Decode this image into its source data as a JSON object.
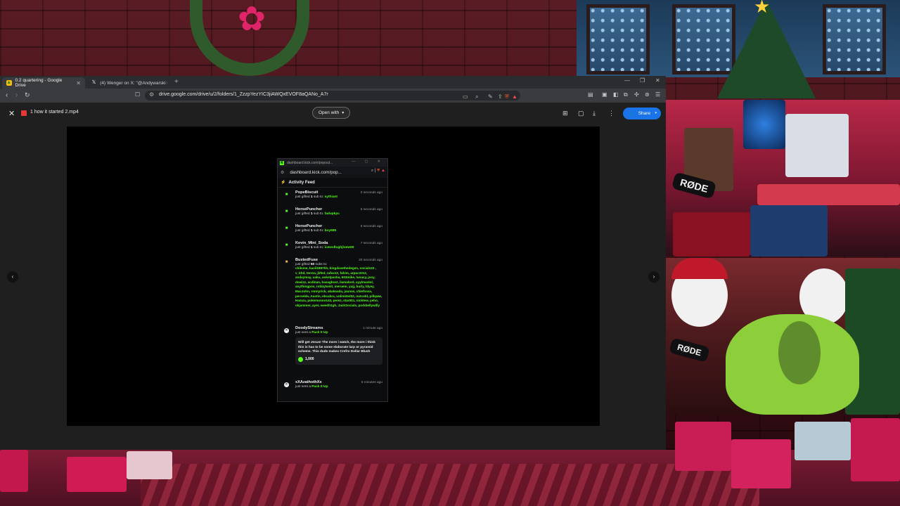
{
  "browser": {
    "tabs": [
      {
        "label": "0.2 quartering - Google Drive",
        "active": true,
        "icon": "google-drive-icon"
      },
      {
        "label": "(4) Wenger on X: \"@Andywarski http",
        "active": false,
        "icon": "x-logo-icon"
      }
    ],
    "url": "drive.google.com/drive/u/2/folders/1_ZzzpYezYIC3jiAWQxEVOF8aQANo_A7r"
  },
  "viewer": {
    "file_name": "1 how it started 2.mp4",
    "open_with_label": "Open with",
    "share_label": "Share"
  },
  "kick": {
    "titlebar_url": "dashboard.kick.com/popout...",
    "address": "dashboard.kick.com/pop...",
    "feed_title": "Activity Feed",
    "items": [
      {
        "user": "PopeBiscuit",
        "time": "0 seconds ago",
        "pre": "just gifted ",
        "count": "1",
        "mid": " sub to: ",
        "target": "sythiant"
      },
      {
        "user": "HorsePuncher",
        "time": "5 seconds ago",
        "pre": "just gifted ",
        "count": "1",
        "mid": " sub to: ",
        "target": "fadupkpc"
      },
      {
        "user": "HorsePuncher",
        "time": "6 seconds ago",
        "pre": "just gifted ",
        "count": "1",
        "mid": " sub to: ",
        "target": "boy985"
      },
      {
        "user": "Kevin_Mini_Soda",
        "time": "7 seconds ago",
        "pre": "just gifted ",
        "count": "1",
        "mid": " sub to: ",
        "target": "icewslloghjloew90"
      }
    ],
    "bulk": {
      "user": "BustedFuse",
      "time": "20 seconds ago",
      "pre": "just gifted ",
      "count": "50",
      "mid": " subs to:",
      "recipients": "chikone, basil1887hh, kingdavethedegen, social123 , v_khd, terrna, jbfed, rafax12, fahim, arpac3312, andaymay, uaku, aokolpasha, 503mike, lunacy, jooy, dowizz, acdinan, basaghost, ilamalord, ayylmaolol, anythingpos, robbytwist, meruem, yujj, burly, ldyey, MacJohn, ronnyrick, akakoada, juunas, chiefsosa, perselde, Austin, ebcabra, unlimited32, outcold, pillqww, Hamza, pokemonno143, perez, star001, nicktew, yeho, okjammer, ayer, weedh1gh, JackSocials, porkbellywilly"
    },
    "kicks": [
      {
        "user": "DoodyStreams",
        "time": "1 minute ago",
        "pre": "just sent a ",
        "item": "Pack It Up",
        "message": "Will get Jesus! The more i watch, the more i think this is has to be some elaborate larp or pyramid scheme. This dude makes Crefro Dollar Blush",
        "amount": "1,000"
      },
      {
        "user": "xXAzathothXx",
        "time": "5 minutes ago",
        "pre": "just sent a ",
        "item": "Pack It Up"
      }
    ]
  },
  "colors": {
    "kick_green": "#53fc18",
    "drive_share_blue": "#1a73e8",
    "browser_bg": "#202124"
  }
}
